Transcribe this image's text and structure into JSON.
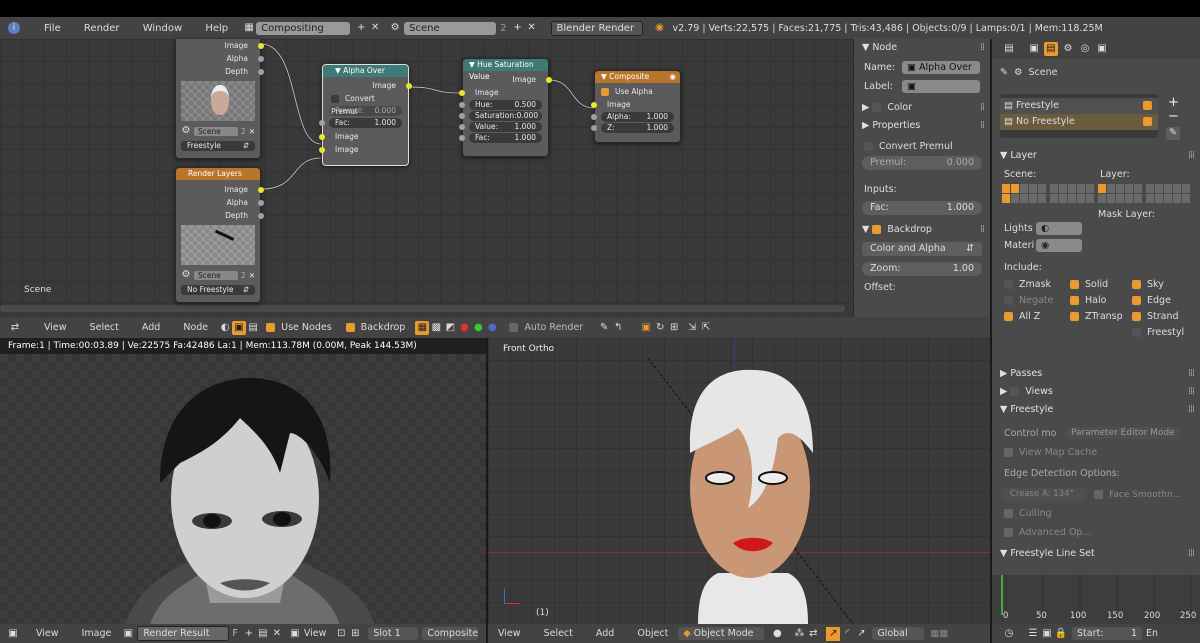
{
  "topbar": {
    "menus": [
      "File",
      "Render",
      "Window",
      "Help"
    ],
    "screen_layout": "Compositing",
    "scene": "Scene",
    "scene_users": "2",
    "engine": "Blender Render",
    "stats": "v2.79 | Verts:22,575 | Faces:21,775 | Tris:43,486 | Objects:0/9 | Lamps:0/1 | Mem:118.25M"
  },
  "node_editor": {
    "scene_label": "Scene",
    "nodes": {
      "rl1": {
        "image": "Image",
        "alpha": "Alpha",
        "depth": "Depth",
        "scene": "Scene",
        "scene_num": "2",
        "layer": "Freestyle"
      },
      "rl2": {
        "title": "Render Layers",
        "image": "Image",
        "alpha": "Alpha",
        "depth": "Depth",
        "scene": "Scene",
        "scene_num": "2",
        "layer": "No Freestyle"
      },
      "alpha_over": {
        "title": "Alpha Over",
        "out_image": "Image",
        "convert": "Convert Premul",
        "premul_label": "Premul:",
        "premul_val": "0.000",
        "fac_label": "Fac:",
        "fac_val": "1.000",
        "in1": "Image",
        "in2": "Image"
      },
      "hsv": {
        "title": "Hue Saturation Value",
        "out_image": "Image",
        "in_image": "Image",
        "hue_label": "Hue:",
        "hue_val": "0.500",
        "sat_label": "Saturation:",
        "sat_val": "0.000",
        "val_label": "Value:",
        "val_val": "1.000",
        "fac_label": "Fac:",
        "fac_val": "1.000"
      },
      "composite": {
        "title": "Composite",
        "use_alpha": "Use Alpha",
        "image": "Image",
        "alpha_label": "Alpha:",
        "alpha_val": "1.000",
        "z_label": "Z:",
        "z_val": "1.000"
      }
    },
    "header": {
      "menus": [
        "View",
        "Select",
        "Add",
        "Node"
      ],
      "use_nodes": "Use Nodes",
      "backdrop": "Backdrop",
      "auto_render": "Auto Render"
    }
  },
  "node_panel": {
    "node_heading": "Node",
    "name_label": "Name:",
    "name_value": "Alpha Over",
    "label_label": "Label:",
    "color": "Color",
    "properties": "Properties",
    "convert_premul": "Convert Premul",
    "premul_label": "Premul:",
    "premul_val": "0.000",
    "inputs": "Inputs:",
    "fac_label": "Fac:",
    "fac_val": "1.000",
    "backdrop": "Backdrop",
    "backdrop_mode": "Color and Alpha",
    "zoom_label": "Zoom:",
    "zoom_val": "1.00",
    "offset": "Offset:"
  },
  "properties_editor": {
    "scene_crumb": "Scene",
    "render_layers": [
      "Freestyle",
      "No Freestyle"
    ],
    "layer_heading": "Layer",
    "scene_label": "Scene:",
    "layer_label": "Layer:",
    "mask_layer": "Mask Layer:",
    "lights": "Lights",
    "materi": "Materi",
    "include": "Include:",
    "include_items": [
      "Zmask",
      "Solid",
      "Sky",
      "Negate",
      "Halo",
      "Edge",
      "All Z",
      "ZTransp",
      "Strand",
      "Freestyl"
    ],
    "passes": "Passes",
    "views": "Views",
    "freestyle": "Freestyle",
    "control_mode_label": "Control mo",
    "control_mode_val": "Parameter Editor Mode",
    "view_map_cache": "View Map Cache",
    "edge_detection": "Edge Detection Options:",
    "crease_angle": "Crease A: 134°",
    "face_smoothness": "Face Smoothn...",
    "culling": "Culling",
    "advanced": "Advanced Op...",
    "line_set": "Freestyle Line Set"
  },
  "image_editor": {
    "info": "Frame:1 | Time:00:03.89 | Ve:22575 Fa:42486 La:1 | Mem:113.78M (0.00M, Peak 144.53M)",
    "menus": [
      "View",
      "Image"
    ],
    "image_name": "Render Result",
    "f_label": "F",
    "view_label": "View",
    "slot": "Slot 1",
    "pass": "Composite"
  },
  "viewport": {
    "label": "Front Ortho",
    "frame": "(1)",
    "menus": [
      "View",
      "Select",
      "Add",
      "Object"
    ],
    "mode": "Object Mode",
    "orientation": "Global"
  },
  "timeline": {
    "ticks": [
      "0",
      "50",
      "100",
      "150",
      "200",
      "250"
    ],
    "start_label": "Start:",
    "start_val": "1",
    "end_label": "En"
  },
  "colors": {
    "accent": "#ea9a2e",
    "socket_yellow": "#e6e62c",
    "header_bg": "#434343"
  }
}
